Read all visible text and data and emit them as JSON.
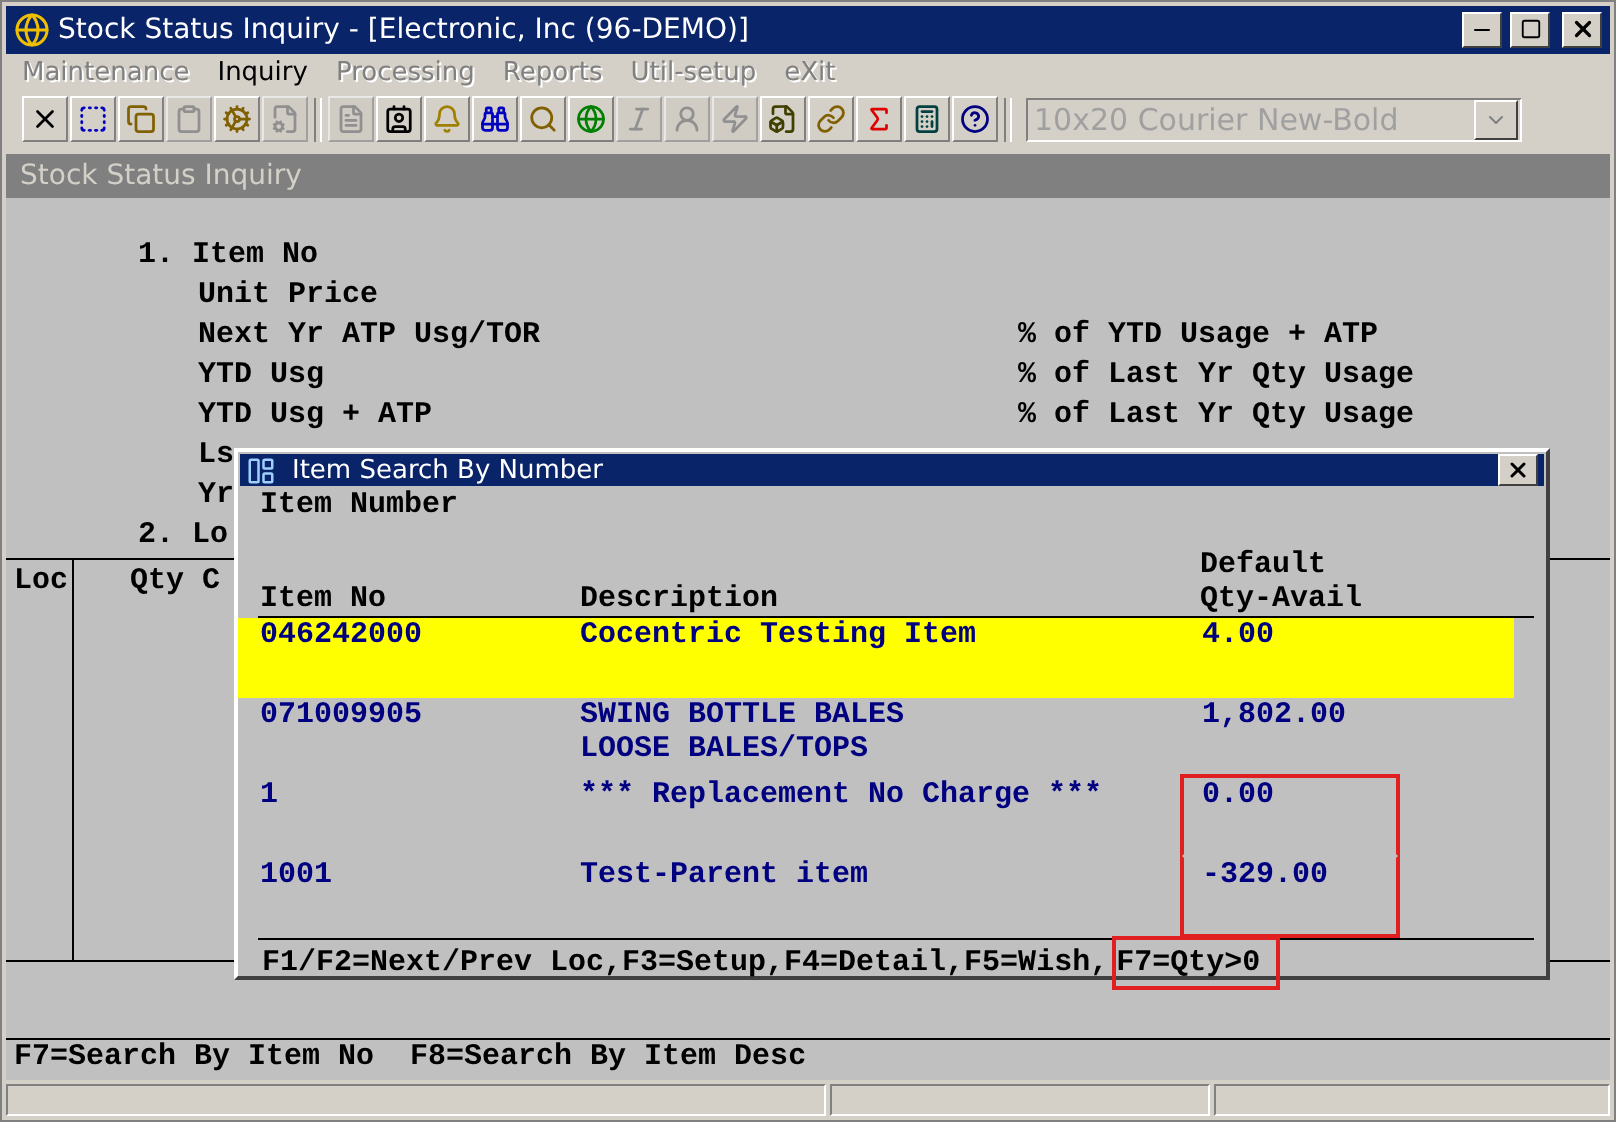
{
  "window": {
    "title": "Stock Status Inquiry - [Electronic, Inc (96-DEMO)]"
  },
  "menu": [
    {
      "label": "Maintenance",
      "disabled": true
    },
    {
      "label": "Inquiry",
      "disabled": false
    },
    {
      "label": "Processing",
      "disabled": true
    },
    {
      "label": "Reports",
      "disabled": true
    },
    {
      "label": "Util-setup",
      "disabled": true
    },
    {
      "label": "eXit",
      "disabled": true
    }
  ],
  "toolbar": [
    {
      "kind": "close",
      "disabled": false
    },
    {
      "kind": "select",
      "disabled": false
    },
    {
      "kind": "copy",
      "disabled": false
    },
    {
      "kind": "paste",
      "disabled": true
    },
    {
      "kind": "gear",
      "disabled": false
    },
    {
      "kind": "properties",
      "disabled": true
    },
    {
      "kind": "separator"
    },
    {
      "kind": "list",
      "disabled": true
    },
    {
      "kind": "contact",
      "disabled": false
    },
    {
      "kind": "bell",
      "disabled": false
    },
    {
      "kind": "binoculars",
      "disabled": false
    },
    {
      "kind": "search",
      "disabled": false
    },
    {
      "kind": "globe",
      "disabled": false
    },
    {
      "kind": "script",
      "disabled": true
    },
    {
      "kind": "person",
      "disabled": true
    },
    {
      "kind": "bolt",
      "disabled": true
    },
    {
      "kind": "filebolt",
      "disabled": false
    },
    {
      "kind": "link",
      "disabled": false
    },
    {
      "kind": "function",
      "disabled": false
    },
    {
      "kind": "calculator",
      "disabled": false
    },
    {
      "kind": "help",
      "disabled": false
    }
  ],
  "font_select": {
    "value": "10x20 Courier New-Bold",
    "disabled": true
  },
  "screen_title": "Stock Status Inquiry",
  "lines": [
    {
      "kind": "numbered",
      "left": "1. Item No"
    },
    {
      "kind": "sub",
      "left": "Unit Price"
    },
    {
      "kind": "sub",
      "left": "Next Yr ATP Usg/TOR",
      "right": "% of YTD Usage + ATP"
    },
    {
      "kind": "sub",
      "left": "YTD Usg",
      "right": "% of Last Yr Qty Usage"
    },
    {
      "kind": "sub",
      "left": "YTD Usg + ATP",
      "right": "% of Last Yr Qty Usage"
    },
    {
      "kind": "sub",
      "left": "Ls"
    },
    {
      "kind": "sub",
      "left": "Yr"
    },
    {
      "kind": "numbered",
      "left": "2. Lo"
    }
  ],
  "table": {
    "columns": [
      "Loc",
      "Qty C"
    ]
  },
  "footer": "F7=Search By Item No  F8=Search By Item Desc",
  "dialog": {
    "title": "Item Search By Number",
    "label": "Item Number",
    "columns": [
      {
        "line_2": "Item No"
      },
      {
        "line_2": "Description"
      },
      {
        "line_1": "Default",
        "line_2": "Qty-Avail"
      }
    ],
    "rows": [
      {
        "item_no": "046242000",
        "description": "Cocentric Testing Item",
        "qty": "4.00",
        "selected": true,
        "boxed": false
      },
      {
        "item_no": "071009905",
        "description": "SWING BOTTLE BALES",
        "description_2": "LOOSE BALES/TOPS",
        "qty": "1,802.00",
        "selected": false,
        "boxed": false
      },
      {
        "item_no": "1",
        "description": "*** Replacement No Charge ***",
        "qty": "0.00",
        "selected": false,
        "boxed": true
      },
      {
        "item_no": "1001",
        "description": "Test-Parent item",
        "qty": "-329.00",
        "selected": false,
        "boxed": true
      }
    ],
    "hints": [
      {
        "text": "F1/F2=Next/Prev Loc,F3=Setup,F4=Detail,F5=Wish,",
        "boxed": false
      },
      {
        "text": "F7=Qty>0",
        "boxed": true
      }
    ]
  }
}
